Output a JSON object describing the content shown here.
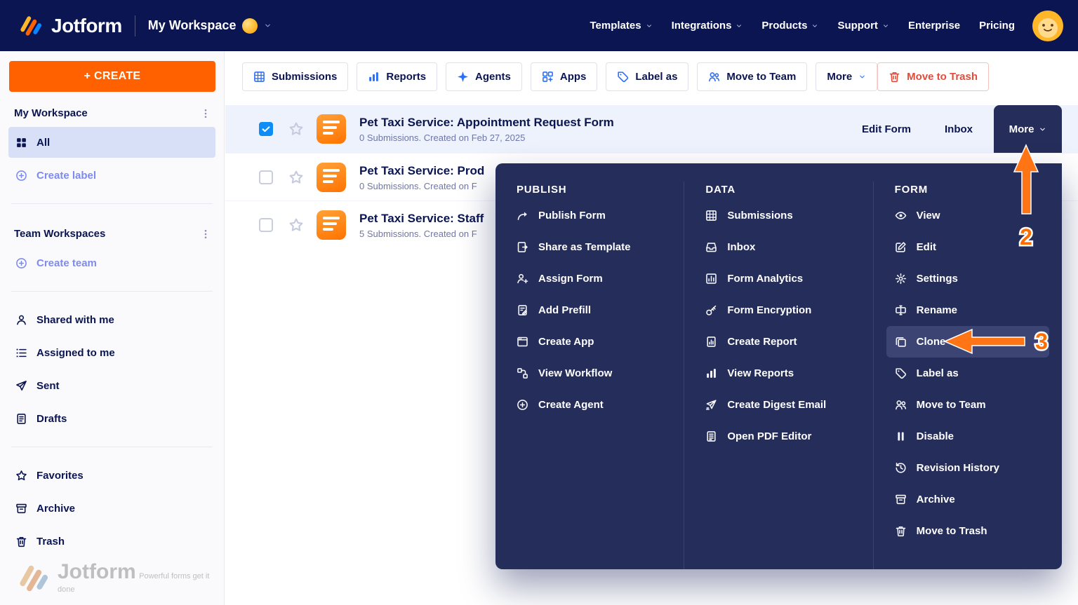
{
  "colors": {
    "brand_orange": "#ff6100",
    "navy": "#0a1551",
    "menu_navy": "#252d5b",
    "icon_blue": "#2d6ff7",
    "danger_red": "#e34c3a",
    "annotation_orange": "#ff6d00",
    "selected_row_bg": "#edf2fd",
    "sidebar_selected_bg": "#d8e0f7",
    "checkbox_blue": "#0d8df5"
  },
  "header": {
    "logo_text": "Jotform",
    "workspace_label": "My Workspace",
    "nav_items": [
      {
        "label": "Templates",
        "chevron": true
      },
      {
        "label": "Integrations",
        "chevron": true
      },
      {
        "label": "Products",
        "chevron": true
      },
      {
        "label": "Support",
        "chevron": true
      },
      {
        "label": "Enterprise",
        "chevron": false
      },
      {
        "label": "Pricing",
        "chevron": false
      }
    ]
  },
  "sidebar": {
    "create_button": "+ CREATE",
    "groups": [
      {
        "heading": "My Workspace",
        "kebab": true,
        "items": [
          {
            "label": "All",
            "icon": "grid-small-icon",
            "selected": true
          },
          {
            "label": "Create label",
            "icon": "plus-circle-icon",
            "accent": true
          }
        ]
      },
      {
        "heading": "Team Workspaces",
        "kebab": true,
        "items": [
          {
            "label": "Create team",
            "icon": "plus-circle-icon",
            "accent": true
          }
        ]
      },
      {
        "items": [
          {
            "label": "Shared with me",
            "icon": "person-icon"
          },
          {
            "label": "Assigned to me",
            "icon": "list-icon"
          },
          {
            "label": "Sent",
            "icon": "send-icon"
          },
          {
            "label": "Drafts",
            "icon": "doc-icon"
          }
        ]
      },
      {
        "items": [
          {
            "label": "Favorites",
            "icon": "star-icon"
          },
          {
            "label": "Archive",
            "icon": "archive-icon"
          },
          {
            "label": "Trash",
            "icon": "trash-icon"
          }
        ]
      }
    ]
  },
  "toolbar": {
    "buttons": [
      {
        "label": "Submissions",
        "icon": "grid-icon"
      },
      {
        "label": "Reports",
        "icon": "chart-icon"
      },
      {
        "label": "Agents",
        "icon": "sparkle-icon"
      },
      {
        "label": "Apps",
        "icon": "apps-icon"
      },
      {
        "label": "Label as",
        "icon": "tag-icon"
      },
      {
        "label": "Move to Team",
        "icon": "users-icon"
      }
    ],
    "more_label": "More",
    "move_to_trash_label": "Move to Trash"
  },
  "forms": [
    {
      "title": "Pet Taxi Service: Appointment Request Form",
      "meta": "0 Submissions. Created on Feb 27, 2025",
      "checked": true,
      "selected": true,
      "actions": {
        "edit": "Edit Form",
        "inbox": "Inbox",
        "more": "More"
      }
    },
    {
      "title": "Pet Taxi Service: Prod",
      "meta": "0 Submissions. Created on F",
      "checked": false
    },
    {
      "title": "Pet Taxi Service: Staff",
      "meta": "5 Submissions. Created on F",
      "checked": false
    }
  ],
  "menu": {
    "columns": [
      {
        "heading": "PUBLISH",
        "items": [
          {
            "label": "Publish Form",
            "icon": "publish-icon"
          },
          {
            "label": "Share as Template",
            "icon": "template-icon"
          },
          {
            "label": "Assign Form",
            "icon": "assign-icon"
          },
          {
            "label": "Add Prefill",
            "icon": "prefill-icon"
          },
          {
            "label": "Create App",
            "icon": "app-icon"
          },
          {
            "label": "View Workflow",
            "icon": "workflow-icon"
          },
          {
            "label": "Create Agent",
            "icon": "plus-circle-icon"
          }
        ]
      },
      {
        "heading": "DATA",
        "items": [
          {
            "label": "Submissions",
            "icon": "grid-icon"
          },
          {
            "label": "Inbox",
            "icon": "inbox-icon"
          },
          {
            "label": "Form Analytics",
            "icon": "analytics-icon"
          },
          {
            "label": "Form Encryption",
            "icon": "key-icon"
          },
          {
            "label": "Create Report",
            "icon": "report-icon"
          },
          {
            "label": "View Reports",
            "icon": "chart-icon"
          },
          {
            "label": "Create Digest Email",
            "icon": "digest-email-icon"
          },
          {
            "label": "Open PDF Editor",
            "icon": "pdf-icon"
          }
        ]
      },
      {
        "heading": "FORM",
        "items": [
          {
            "label": "View",
            "icon": "eye-icon"
          },
          {
            "label": "Edit",
            "icon": "edit-icon"
          },
          {
            "label": "Settings",
            "icon": "gear-icon"
          },
          {
            "label": "Rename",
            "icon": "rename-icon"
          },
          {
            "label": "Clone",
            "icon": "clone-icon",
            "highlighted": true
          },
          {
            "label": "Label as",
            "icon": "tag-icon"
          },
          {
            "label": "Move to Team",
            "icon": "users-icon"
          },
          {
            "label": "Disable",
            "icon": "pause-icon"
          },
          {
            "label": "Revision History",
            "icon": "history-icon"
          },
          {
            "label": "Archive",
            "icon": "archive-icon"
          },
          {
            "label": "Move to Trash",
            "icon": "trash-icon"
          }
        ]
      }
    ]
  },
  "annotations": {
    "step2": "2",
    "step3": "3"
  },
  "watermark": {
    "brand": "Jotform",
    "tagline": "Powerful forms get it done"
  }
}
